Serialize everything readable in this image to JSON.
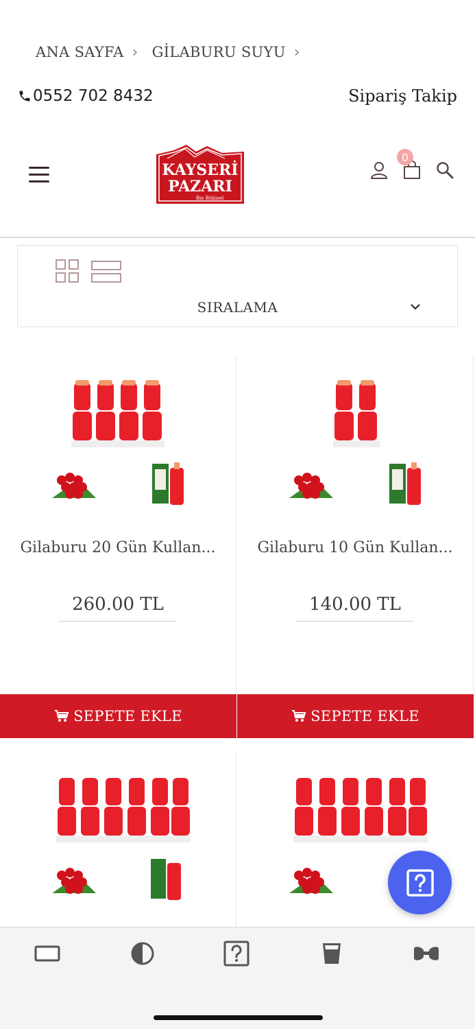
{
  "breadcrumb": {
    "home": "ANA SAYFA",
    "current": "GİLABURU SUYU"
  },
  "contact": {
    "phone": "0552 702 8432",
    "order_tracking": "Sipariş Takip"
  },
  "header": {
    "logo_line1": "KAYSERİ",
    "logo_line2": "PAZARI",
    "logo_tagline": "Bio Bitkisel",
    "cart_count": "0"
  },
  "toolbar": {
    "sort_label": "SIRALAMA"
  },
  "products": [
    {
      "name": "Gilaburu 20 Gün Kullan...",
      "price": "260.00 TL",
      "add_label": "SEPETE EKLE"
    },
    {
      "name": "Gilaburu 10 Gün Kullan...",
      "price": "140.00 TL",
      "add_label": "SEPETE EKLE"
    },
    {
      "name": "",
      "price": "",
      "add_label": ""
    },
    {
      "name": "",
      "price": "",
      "add_label": ""
    }
  ],
  "colors": {
    "brand_red": "#d01a26",
    "fab_blue": "#4c63f0",
    "badge_pink": "#f4a5a5"
  }
}
